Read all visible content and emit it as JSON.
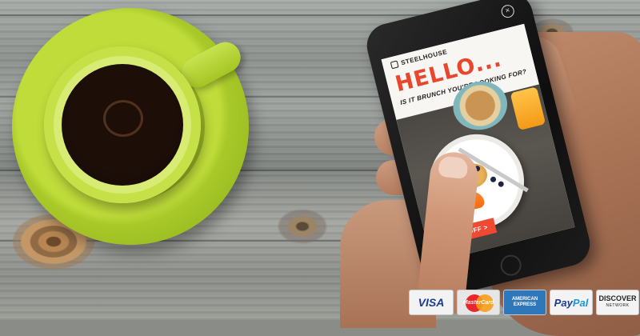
{
  "ad": {
    "brand": "STEELHOUSE",
    "close": "×",
    "headline": "HELLO...",
    "subheadline": "IS IT BRUNCH YOU'RE LOOKING FOR?",
    "cta": "GET $20 OFF >"
  },
  "payment_cards": {
    "visa": "VISA",
    "mastercard": "MasterCard",
    "amex_line1": "AMERICAN",
    "amex_line2": "EXPRESS",
    "paypal_a": "Pay",
    "paypal_b": "Pal",
    "discover": "DISCOVER",
    "discover_sub": "NETWORK"
  },
  "colors": {
    "accent_red": "#e8472d",
    "saucer_green": "#b4d335"
  },
  "icons": [
    "coffee-cup",
    "smartphone",
    "close-icon",
    "steelhouse-logo-icon"
  ]
}
